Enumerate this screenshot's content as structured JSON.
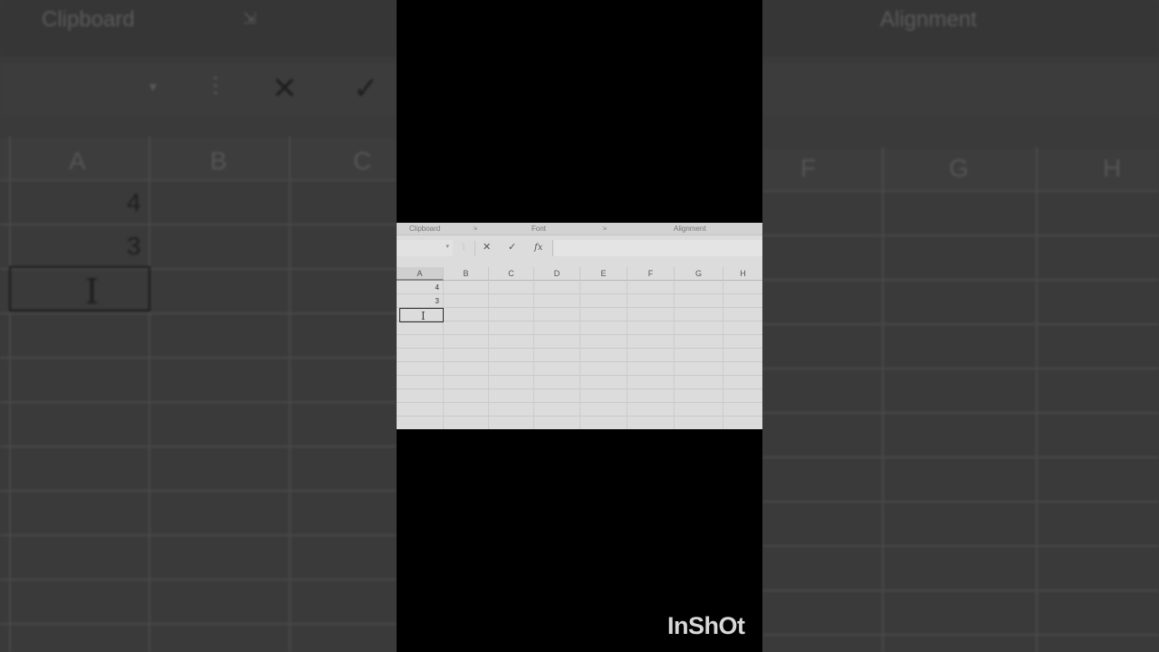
{
  "ribbon": {
    "clipboard_label": "Clipboard",
    "font_label": "Font",
    "alignment_label": "Alignment"
  },
  "formula_bar": {
    "cancel_glyph": "✕",
    "enter_glyph": "✓",
    "fx_label": "fx",
    "value": ""
  },
  "sheet": {
    "columns": [
      "A",
      "B",
      "C",
      "D",
      "E",
      "F",
      "G",
      "H"
    ],
    "selected_column": "A",
    "cells": {
      "A1": "4",
      "A2": "3",
      "A3": ""
    },
    "active_cell": "A3"
  },
  "watermark": "InShOt"
}
